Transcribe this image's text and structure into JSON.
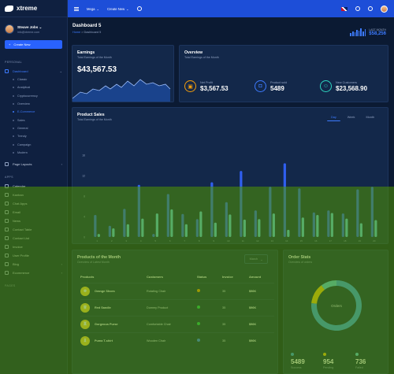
{
  "app": {
    "name": "xtreme"
  },
  "profile": {
    "name": "Steave Jobs",
    "email": "info@xtreme.com"
  },
  "sidebar": {
    "create_label": "Create New",
    "personal_title": "PERSONAL",
    "dashboard_label": "Dashboard",
    "dashboard_sub": [
      "Classic",
      "Analytical",
      "Cryptocurrency",
      "Overview",
      "E-Commerce",
      "Sales",
      "General",
      "Trendy",
      "Campaign",
      "Modern"
    ],
    "page_layouts": "Page Layouts",
    "apps_title": "APPS",
    "apps": [
      "Calendar",
      "Kanban",
      "Chat Apps",
      "Email",
      "News",
      "Contact Table",
      "Contact List",
      "Invoice",
      "User Profile",
      "Blog",
      "Ecommerce"
    ],
    "pages_title": "PAGES"
  },
  "topbar": {
    "mega": "Mega",
    "create_new": "Create New"
  },
  "header": {
    "title": "Dashboard 5",
    "crumb_home": "Home",
    "crumb_sep": ">",
    "crumb_current": "Dashboard 5",
    "last_month_label": "LAST MONTH",
    "last_month_value": "$58,256"
  },
  "earnings": {
    "title": "Earnings",
    "subtitle": "Total Earnings of the Month",
    "value": "$43,567.53"
  },
  "overview": {
    "title": "Overview",
    "subtitle": "Total Earnings of the Month",
    "items": [
      {
        "label": "Net Profit",
        "value": "$3,567.53",
        "color": "#f59e0b",
        "icon": "wallet-icon"
      },
      {
        "label": "Product sold",
        "value": "5489",
        "color": "#3d7bff",
        "icon": "bag-icon"
      },
      {
        "label": "New Customers",
        "value": "$23,568.90",
        "color": "#2dd4bf",
        "icon": "user-icon"
      }
    ]
  },
  "product_sales": {
    "title": "Product Sales",
    "subtitle": "Total Earnings of the Month",
    "tabs": [
      "Day",
      "Week",
      "Month"
    ],
    "active_tab": "Day"
  },
  "chart_data": {
    "type": "bar",
    "title": "Product Sales",
    "y_ticks": [
      16,
      12,
      8,
      4,
      0
    ],
    "ylim": [
      0,
      16
    ],
    "categories": [
      "1",
      "2",
      "3",
      "4",
      "5",
      "6",
      "7",
      "8",
      "9",
      "10",
      "11",
      "12",
      "13",
      "14",
      "15",
      "16",
      "17",
      "18",
      "19",
      "20"
    ],
    "series": [
      {
        "values": [
          4.3,
          2.2,
          5.5,
          10.2,
          0.6,
          8.4,
          4.5,
          3.5,
          10.7,
          6.8,
          12.9,
          5.2,
          9.8,
          14.4,
          9.5,
          4.8,
          5.2,
          4.6,
          9.3,
          9.8
        ],
        "color": "#2f5ff0"
      },
      {
        "values": [
          0.6,
          1.7,
          2.5,
          3.6,
          4.6,
          5.4,
          2.5,
          5.0,
          2.8,
          4.4,
          3.4,
          3.5,
          4.6,
          1.4,
          3.8,
          4.3,
          4.7,
          3.6,
          2.7,
          3.3
        ],
        "color": "#5ec8e0"
      }
    ],
    "colors": {
      "primary": "#2f5ff0",
      "secondary": "#5ec8e0"
    }
  },
  "products": {
    "title": "Products of the Month",
    "subtitle": "Overview of Latest Month",
    "month_select": "March",
    "columns": [
      "Products",
      "Customers",
      "Status",
      "Invoice",
      "Amount"
    ],
    "rows": [
      {
        "product": "Orange Shoes",
        "customer": "Rotating Chair",
        "status_color": "#f59e0b",
        "invoice": "35",
        "amount": "$96K"
      },
      {
        "product": "Red Sandle",
        "customer": "Dummy Product",
        "status_color": "#22c55e",
        "invoice": "35",
        "amount": "$96K"
      },
      {
        "product": "Gorgeous Purse",
        "customer": "Comfortable Chair",
        "status_color": "#22c55e",
        "invoice": "35",
        "amount": "$96K"
      },
      {
        "product": "Puma T-shirt",
        "customer": "Wooden Chair",
        "status_color": "#3d7bff",
        "invoice": "35",
        "amount": "$96K"
      }
    ]
  },
  "order_stats": {
    "title": "Order Stats",
    "subtitle": "Overview of orders",
    "center_label": "Orders",
    "donut": [
      {
        "name": "Success",
        "value": 5489,
        "color": "#3d9be9"
      },
      {
        "name": "Pending",
        "value": 954,
        "color": "#f5c518"
      },
      {
        "name": "Failed",
        "value": 736,
        "color": "#5ec8e0"
      }
    ],
    "stats": [
      {
        "value": "5489",
        "label": "Success",
        "color": "#3d9be9"
      },
      {
        "value": "954",
        "label": "Pending",
        "color": "#f5c518"
      },
      {
        "value": "736",
        "label": "Failed",
        "color": "#5ec8e0"
      }
    ]
  }
}
